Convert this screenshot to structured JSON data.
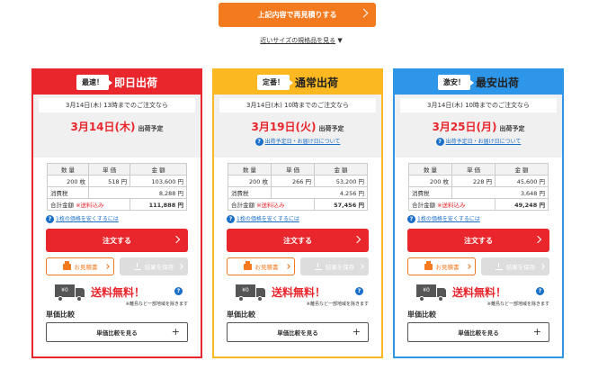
{
  "top_button": {
    "label": "上記内容で再見積りする"
  },
  "size_link": {
    "label": "近いサイズの規格品を見る",
    "arrow": "▼"
  },
  "columns": [
    {
      "badge": "最速！",
      "title": "即日出荷",
      "cutoff": "3月14日(木) 13時までのご注文なら",
      "ship_date": "3月14日(木)",
      "ship_label": "出荷予定",
      "schedule_link": "",
      "headers": {
        "qty": "数 量",
        "unit": "単 価",
        "amount": "金 額"
      },
      "qty": "200 枚",
      "unit": "518 円",
      "amount": "103,600 円",
      "tax_label": "消費税",
      "tax": "8,288 円",
      "total_label": "合計金額",
      "shipping_incl": "※送料込み",
      "total": "111,888 円",
      "cheap_link": "1枚の価格を安くするには",
      "order": "注文する",
      "estimate": "お見積書",
      "save": "結果を保存",
      "free_box": "¥0",
      "free_text": "送料無料！",
      "free_note": "※離島など一部地域を除きます",
      "compare_title": "単価比較",
      "compare_button": "単価比較を見る",
      "plus": "+"
    },
    {
      "badge": "定番！",
      "title": "通常出荷",
      "cutoff": "3月14日(木) 10時までのご注文なら",
      "ship_date": "3月19日(火)",
      "ship_label": "出荷予定",
      "schedule_link": "出荷予定日・お届け日について",
      "headers": {
        "qty": "数 量",
        "unit": "単 価",
        "amount": "金 額"
      },
      "qty": "200 枚",
      "unit": "266 円",
      "amount": "53,200 円",
      "tax_label": "消費税",
      "tax": "4,256 円",
      "total_label": "合計金額",
      "shipping_incl": "※送料込み",
      "total": "57,456 円",
      "cheap_link": "1枚の価格を安くするには",
      "order": "注文する",
      "estimate": "お見積書",
      "save": "結果を保存",
      "free_box": "¥0",
      "free_text": "送料無料！",
      "free_note": "※離島など一部地域を除きます",
      "compare_title": "単価比較",
      "compare_button": "単価比較を見る",
      "plus": "+"
    },
    {
      "badge": "激安！",
      "title": "最安出荷",
      "cutoff": "3月14日(木) 10時までのご注文なら",
      "ship_date": "3月25日(月)",
      "ship_label": "出荷予定",
      "schedule_link": "出荷予定日・お届け日について",
      "headers": {
        "qty": "数 量",
        "unit": "単 価",
        "amount": "金 額"
      },
      "qty": "200 枚",
      "unit": "228 円",
      "amount": "45,600 円",
      "tax_label": "消費税",
      "tax": "3,648 円",
      "total_label": "合計金額",
      "shipping_incl": "※送料込み",
      "total": "49,248 円",
      "cheap_link": "1枚の価格を安くするには",
      "order": "注文する",
      "estimate": "お見積書",
      "save": "結果を保存",
      "free_box": "¥0",
      "free_text": "送料無料！",
      "free_note": "※離島など一部地域を除きます",
      "compare_title": "単価比較",
      "compare_button": "単価比較を見る",
      "plus": "+"
    }
  ],
  "colors": {
    "red": "#e8262c",
    "yellow": "#fbb820",
    "blue": "#2e96e8",
    "orange": "#f47a20"
  }
}
